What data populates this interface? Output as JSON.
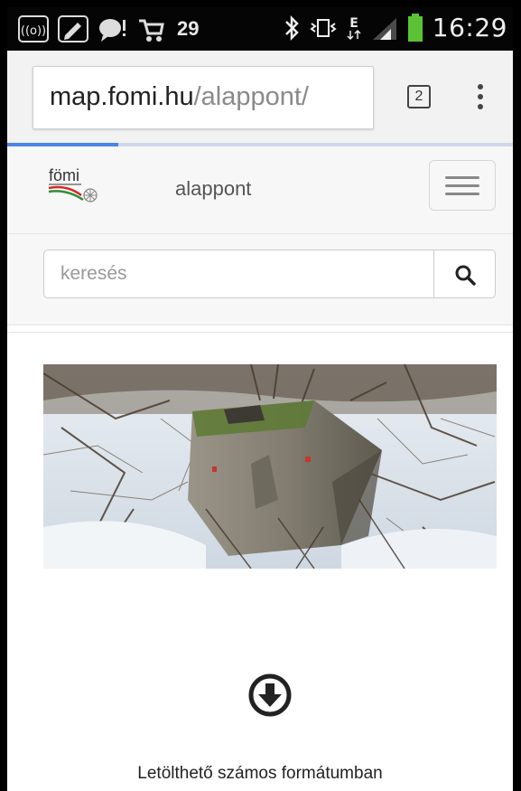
{
  "status_bar": {
    "notification_count": "29",
    "time": "16:29",
    "network_label": "E",
    "icons": [
      "wifi-hotspot-icon",
      "edit-icon",
      "chat-alert-icon",
      "cart-icon",
      "bluetooth-icon",
      "vibrate-icon",
      "network-e-icon",
      "signal-icon",
      "battery-icon"
    ]
  },
  "browser": {
    "url_host": "map.fomi.hu",
    "url_path": "/alappont/",
    "tab_count": "2",
    "load_progress": 0.22
  },
  "navbar": {
    "logo_text": "fömi",
    "brand": "alappont"
  },
  "search": {
    "placeholder": "keresés",
    "value": ""
  },
  "content": {
    "caption": "Letölthető számos formátumban"
  },
  "colors": {
    "accent": "#4a86e8",
    "battery": "#5bc236",
    "logo_red": "#d62828",
    "logo_green": "#2f8f3a"
  }
}
